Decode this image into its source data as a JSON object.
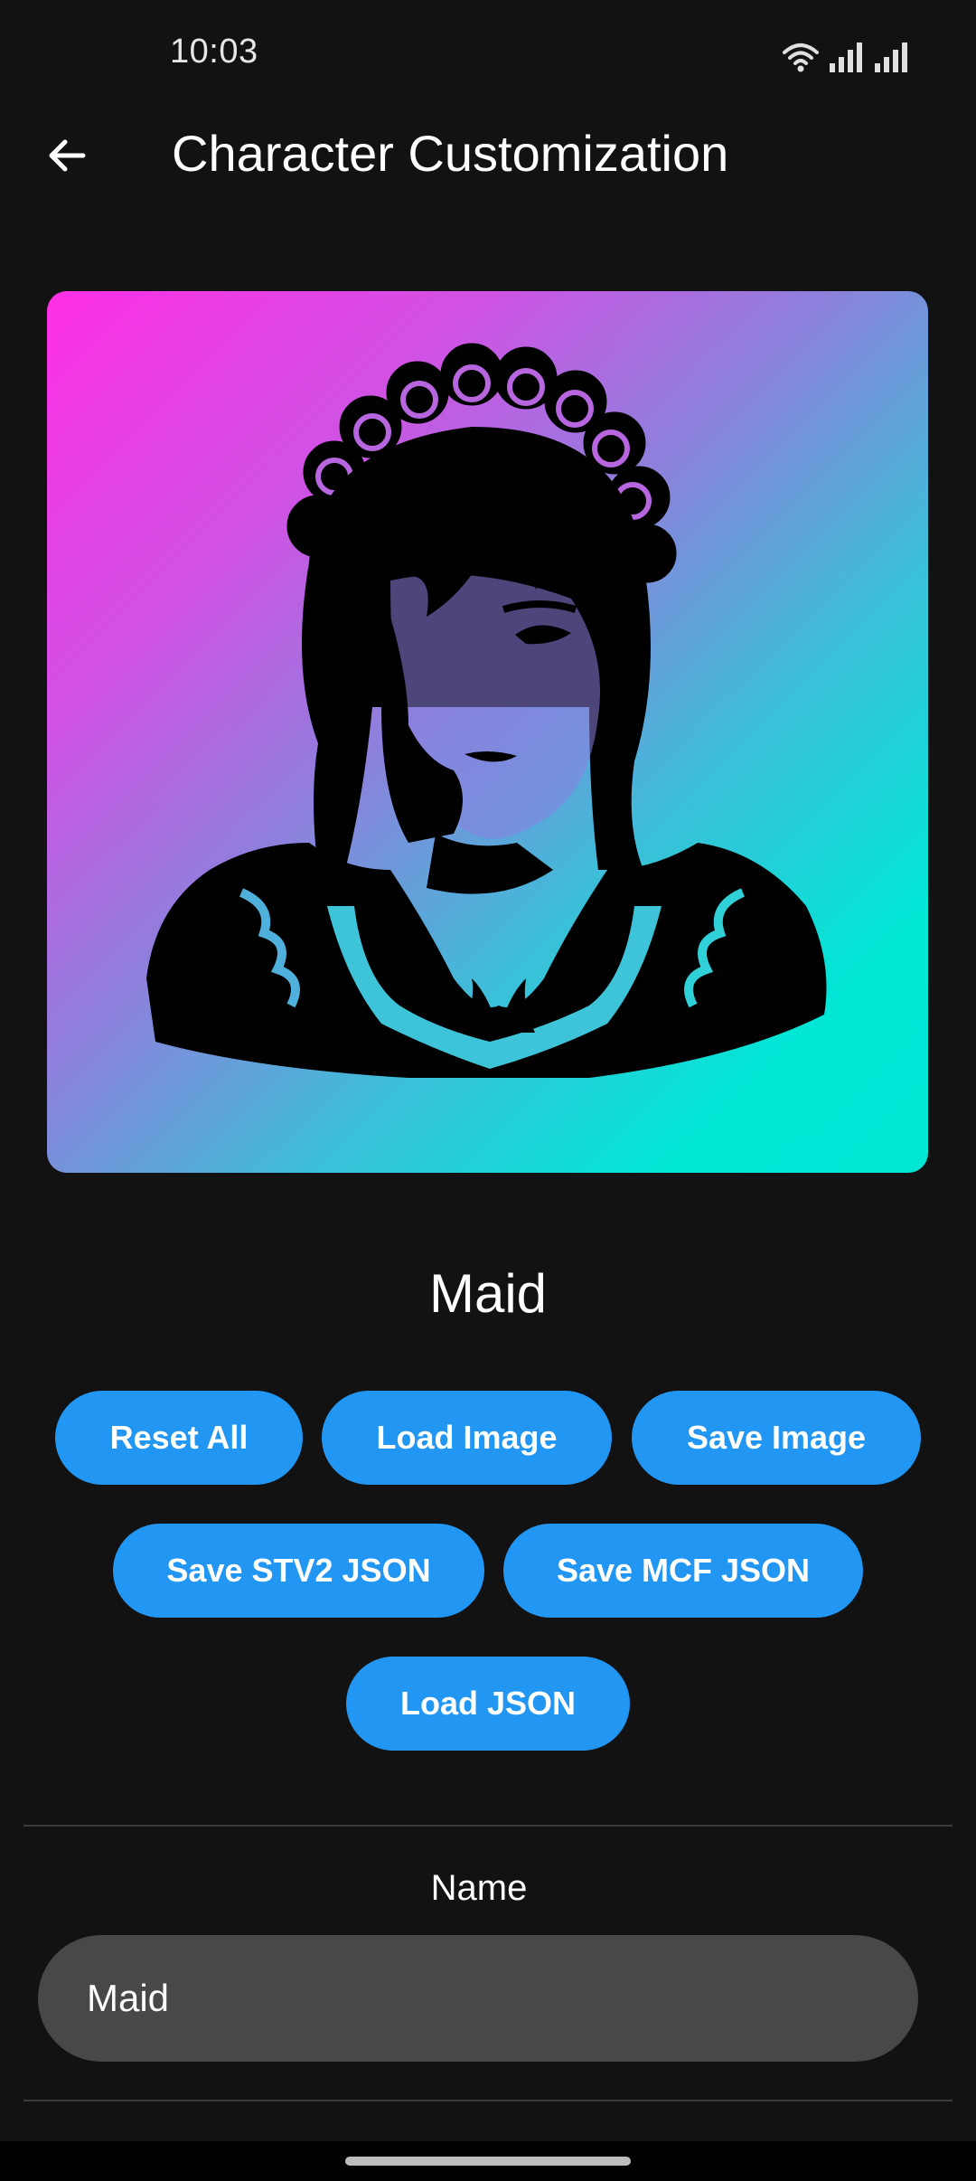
{
  "status_bar": {
    "time": "10:03",
    "icons": [
      "wifi-icon",
      "signal-icon",
      "signal-icon"
    ]
  },
  "app_bar": {
    "title": "Character Customization",
    "back_icon": "arrow-left-icon"
  },
  "character": {
    "name": "Maid"
  },
  "buttons": {
    "reset_all": "Reset All",
    "load_image": "Load Image",
    "save_image": "Save Image",
    "save_stv2_json": "Save STV2 JSON",
    "save_mcf_json": "Save MCF JSON",
    "load_json": "Load JSON"
  },
  "form": {
    "name_label": "Name",
    "name_value": "Maid"
  },
  "colors": {
    "background": "#121212",
    "accent": "#2196f3",
    "input_bg": "#484848",
    "portrait_gradient_start": "#ff2fe6",
    "portrait_gradient_end": "#00e6d5"
  }
}
